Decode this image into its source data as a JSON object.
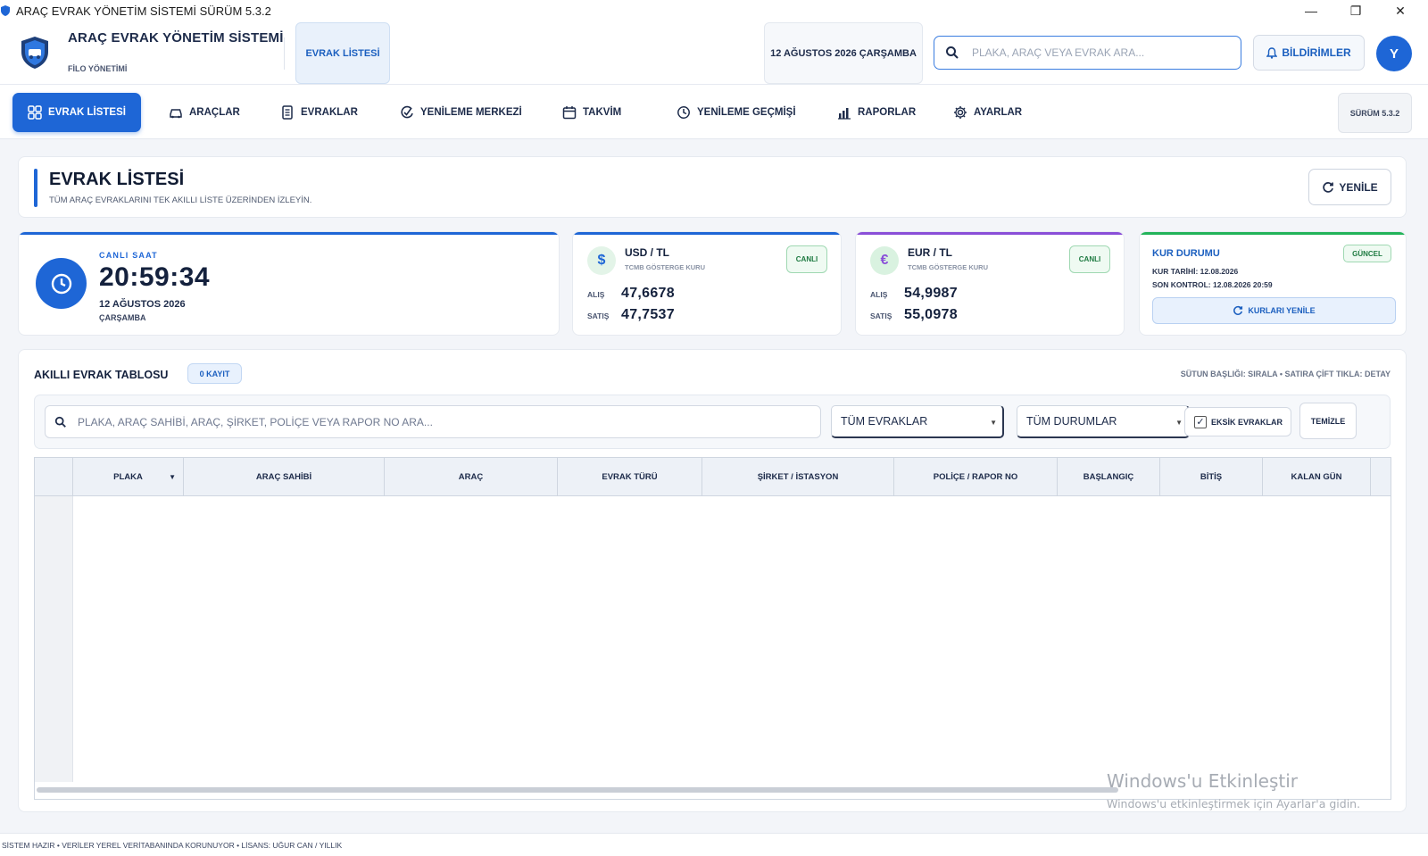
{
  "window": {
    "title": "ARAÇ EVRAK YÖNETİM SİSTEMİ  SÜRÜM 5.3.2",
    "minimize": "—",
    "restore": "❐",
    "close": "✕"
  },
  "header": {
    "brand_title": "ARAÇ EVRAK YÖNETİM SİSTEMİ",
    "brand_sub": "FİLO YÖNETİMİ",
    "active_tab": "EVRAK LİSTESİ",
    "date": "12 AĞUSTOS 2026 ÇARŞAMBA",
    "search_placeholder": "PLAKA, ARAÇ VEYA EVRAK ARA...",
    "notifications": "BİLDİRİMLER",
    "avatar_letter": "Y"
  },
  "nav": {
    "items": [
      {
        "label": "EVRAK LİSTESİ",
        "icon": "grid-icon"
      },
      {
        "label": "ARAÇLAR",
        "icon": "car-icon"
      },
      {
        "label": "EVRAKLAR",
        "icon": "document-icon"
      },
      {
        "label": "YENİLEME MERKEZİ",
        "icon": "renew-check-icon"
      },
      {
        "label": "TAKVİM",
        "icon": "calendar-icon"
      },
      {
        "label": "YENİLEME GEÇMİŞİ",
        "icon": "history-icon"
      },
      {
        "label": "RAPORLAR",
        "icon": "bar-chart-icon"
      },
      {
        "label": "AYARLAR",
        "icon": "gear-icon"
      }
    ],
    "version": "SÜRÜM 5.3.2"
  },
  "page": {
    "title": "EVRAK LİSTESİ",
    "subtitle": "TÜM ARAÇ EVRAKLARINI TEK AKILLI LİSTE ÜZERİNDEN İZLEYİN.",
    "refresh": "YENİLE"
  },
  "clock_card": {
    "label": "CANLI SAAT",
    "time": "20:59:34",
    "date": "12 AĞUSTOS 2026",
    "day": "ÇARŞAMBA",
    "accent": "#1e66d6"
  },
  "usd_card": {
    "symbol": "$",
    "name": "USD / TL",
    "sub": "TCMB GÖSTERGE KURU",
    "badge": "CANLI",
    "buy_label": "ALIŞ",
    "buy": "47,6678",
    "sell_label": "SATIŞ",
    "sell": "47,7537",
    "accent": "#1e66d6"
  },
  "eur_card": {
    "symbol": "€",
    "name": "EUR / TL",
    "sub": "TCMB GÖSTERGE KURU",
    "badge": "CANLI",
    "buy_label": "ALIŞ",
    "buy": "54,9987",
    "sell_label": "SATIŞ",
    "sell": "55,0978",
    "accent": "#8a4fd8"
  },
  "rate_status": {
    "title": "KUR DURUMU",
    "badge": "GÜNCEL",
    "rate_date": "KUR TARİHİ: 12.08.2026",
    "last_check": "SON KONTROL: 12.08.2026 20:59",
    "refresh": "KURLARI YENİLE",
    "accent": "#23b35a"
  },
  "table_panel": {
    "title": "AKILLI EVRAK TABLOSU",
    "count": "0 KAYIT",
    "hint": "SÜTUN BAŞLIĞI: SIRALA  •  SATIRA ÇİFT TIKLA: DETAY",
    "search_placeholder": "PLAKA, ARAÇ SAHİBİ, ARAÇ, ŞİRKET, POLİÇE VEYA RAPOR NO ARA...",
    "doc_filter": "TÜM EVRAKLAR",
    "status_filter": "TÜM DURUMLAR",
    "missing_docs": "EKSİK EVRAKLAR",
    "missing_checked": true,
    "clear": "TEMİZLE",
    "columns": [
      "PLAKA",
      "ARAÇ SAHİBİ",
      "ARAÇ",
      "EVRAK TÜRÜ",
      "ŞİRKET / İSTASYON",
      "POLİÇE / RAPOR NO",
      "BAŞLANGIÇ",
      "BİTİŞ",
      "KALAN GÜN"
    ],
    "rows": []
  },
  "watermark": {
    "line1": "Windows'u Etkinleştir",
    "line2": "Windows'u etkinleştirmek için Ayarlar'a gidin."
  },
  "status_bar": "SİSTEM HAZIR  •  VERİLER YEREL VERİTABANINDA KORUNUYOR  •  LİSANS: UĞUR CAN / YILLIK"
}
